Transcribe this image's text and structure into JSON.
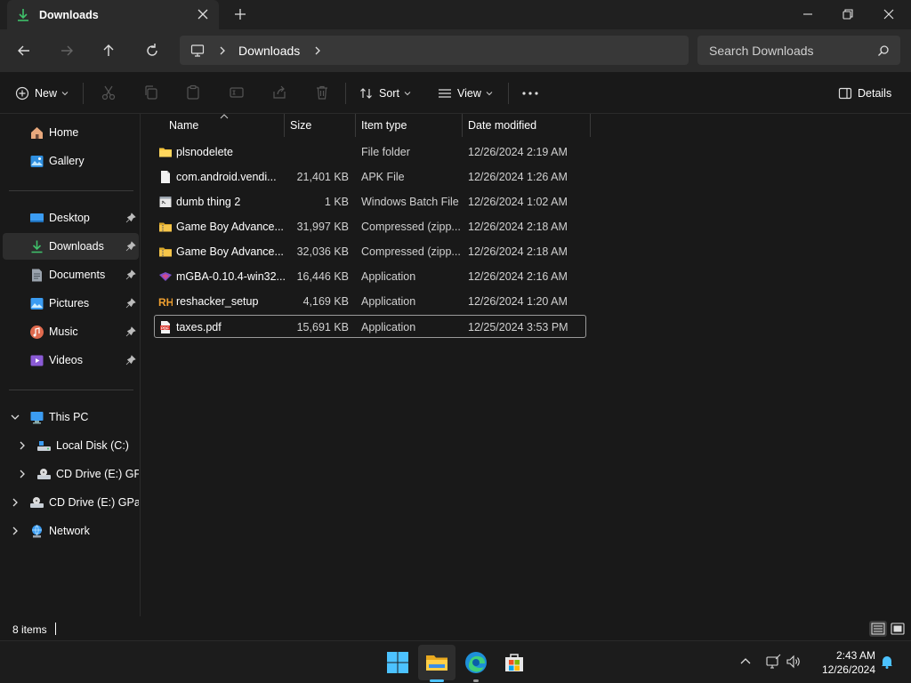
{
  "window": {
    "tab_title": "Downloads",
    "controls": [
      "minimize-icon",
      "restore-icon",
      "close-icon"
    ]
  },
  "nav": {
    "breadcrumb": [
      "This PC",
      "Downloads"
    ],
    "current": "Downloads",
    "search_placeholder": "Search Downloads"
  },
  "commandbar": {
    "new_label": "New",
    "sort_label": "Sort",
    "view_label": "View",
    "details_label": "Details"
  },
  "sidebar": {
    "quick": [
      {
        "label": "Home",
        "icon": "home-icon"
      },
      {
        "label": "Gallery",
        "icon": "gallery-icon"
      }
    ],
    "pinned": [
      {
        "label": "Desktop",
        "icon": "desktop-icon",
        "pinned": true
      },
      {
        "label": "Downloads",
        "icon": "download-icon",
        "pinned": true,
        "selected": true
      },
      {
        "label": "Documents",
        "icon": "documents-icon",
        "pinned": true
      },
      {
        "label": "Pictures",
        "icon": "pictures-icon",
        "pinned": true
      },
      {
        "label": "Music",
        "icon": "music-icon",
        "pinned": true
      },
      {
        "label": "Videos",
        "icon": "videos-icon",
        "pinned": true
      }
    ],
    "tree": [
      {
        "label": "This PC",
        "icon": "pc-icon",
        "expanded": true
      },
      {
        "label": "Local Disk (C:)",
        "icon": "drive-icon"
      },
      {
        "label": "CD Drive (E:) GParted-live",
        "icon": "cd-drive-icon"
      },
      {
        "label": "CD Drive (E:) GParted-live",
        "icon": "cd-drive-icon"
      },
      {
        "label": "Network",
        "icon": "network-icon"
      }
    ]
  },
  "columns": {
    "name": "Name",
    "size": "Size",
    "type": "Item type",
    "date": "Date modified"
  },
  "files": [
    {
      "name": "plsnodelete",
      "size": "",
      "type": "File folder",
      "date": "12/26/2024 2:19 AM",
      "icon": "folder-icon"
    },
    {
      "name": "com.android.vendi...",
      "size": "21,401 KB",
      "type": "APK File",
      "date": "12/26/2024 1:26 AM",
      "icon": "file-icon"
    },
    {
      "name": "dumb thing 2",
      "size": "1 KB",
      "type": "Windows Batch File",
      "date": "12/26/2024 1:02 AM",
      "icon": "batch-file-icon"
    },
    {
      "name": "Game Boy Advance...",
      "size": "31,997 KB",
      "type": "Compressed (zipp...",
      "date": "12/26/2024 2:18 AM",
      "icon": "zip-folder-icon"
    },
    {
      "name": "Game Boy Advance...",
      "size": "32,036 KB",
      "type": "Compressed (zipp...",
      "date": "12/26/2024 2:18 AM",
      "icon": "zip-folder-icon"
    },
    {
      "name": "mGBA-0.10.4-win32...",
      "size": "16,446 KB",
      "type": "Application",
      "date": "12/26/2024 2:16 AM",
      "icon": "mgba-app-icon"
    },
    {
      "name": "reshacker_setup",
      "size": "4,169 KB",
      "type": "Application",
      "date": "12/26/2024 1:20 AM",
      "icon": "reshacker-icon"
    },
    {
      "name": "taxes.pdf",
      "size": "15,691 KB",
      "type": "Application",
      "date": "12/25/2024 3:53 PM",
      "icon": "pdf-icon",
      "focused": true
    }
  ],
  "status": {
    "item_count": "8 items"
  },
  "taskbar": {
    "apps": [
      "windows-start-icon",
      "file-explorer-icon",
      "edge-icon",
      "store-icon"
    ],
    "time": "2:43 AM",
    "date": "12/26/2024"
  },
  "colors": {
    "accent": "#4cc2ff",
    "folder": "#f8c63d",
    "background": "#191919",
    "selected_bg": "#2d2d2d"
  }
}
